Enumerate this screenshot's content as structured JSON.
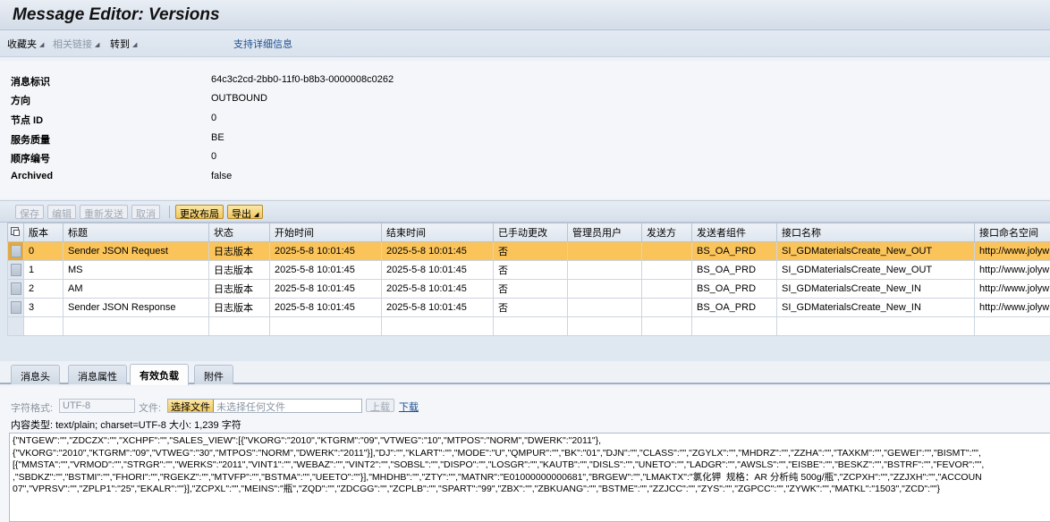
{
  "title": "Message Editor: Versions",
  "menu": {
    "favorites": "收藏夹",
    "related_links": "相关链接",
    "goto": "转到",
    "support": "支持详细信息"
  },
  "header_fields": [
    {
      "label": "消息标识",
      "value": "64c3c2cd-2bb0-11f0-b8b3-0000008c0262"
    },
    {
      "label": "方向",
      "value": "OUTBOUND"
    },
    {
      "label": "节点 ID",
      "value": "0"
    },
    {
      "label": "服务质量",
      "value": "BE"
    },
    {
      "label": "顺序编号",
      "value": "0"
    },
    {
      "label": "Archived",
      "value": "false"
    }
  ],
  "toolbar": {
    "save": "保存",
    "edit": "编辑",
    "resend": "重新发送",
    "cancel": "取消",
    "change_layout": "更改布局",
    "export": "导出"
  },
  "table": {
    "columns": [
      "版本",
      "标题",
      "状态",
      "开始时间",
      "结束时间",
      "已手动更改",
      "管理员用户",
      "发送方",
      "发送者组件",
      "接口名称",
      "接口命名空间"
    ],
    "rows": [
      [
        "0",
        "Sender JSON Request",
        "日志版本",
        "2025-5-8 10:01:45",
        "2025-5-8 10:01:45",
        "否",
        "",
        "",
        "BS_OA_PRD",
        "SI_GDMaterialsCreate_New_OUT",
        "http://www.jolyw"
      ],
      [
        "1",
        "MS",
        "日志版本",
        "2025-5-8 10:01:45",
        "2025-5-8 10:01:45",
        "否",
        "",
        "",
        "BS_OA_PRD",
        "SI_GDMaterialsCreate_New_OUT",
        "http://www.jolyw"
      ],
      [
        "2",
        "AM",
        "日志版本",
        "2025-5-8 10:01:45",
        "2025-5-8 10:01:45",
        "否",
        "",
        "",
        "BS_OA_PRD",
        "SI_GDMaterialsCreate_New_IN",
        "http://www.jolyw"
      ],
      [
        "3",
        "Sender JSON Response",
        "日志版本",
        "2025-5-8 10:01:45",
        "2025-5-8 10:01:45",
        "否",
        "",
        "",
        "BS_OA_PRD",
        "SI_GDMaterialsCreate_New_IN",
        "http://www.jolyw"
      ]
    ]
  },
  "tabs": [
    "消息头",
    "消息属性",
    "有效负载",
    "附件"
  ],
  "payload": {
    "charset_label": "字符格式:",
    "charset_value": "UTF-8",
    "file_label": "文件:",
    "choose_file": "选择文件",
    "no_file": "未选择任何文件",
    "upload": "上载",
    "download": "下载",
    "content_type_label": "内容类型:",
    "content_type_value": "text/plain; charset=UTF-8",
    "size_label": "大小:",
    "size_value": "1,239 字符",
    "lines": [
      "{\"NTGEW\":\"\",\"ZDCZX\":\"\",\"XCHPF\":\"\",\"SALES_VIEW\":[{\"VKORG\":\"2010\",\"KTGRM\":\"09\",\"VTWEG\":\"10\",\"MTPOS\":\"NORM\",\"DWERK\":\"2011\"},",
      "{\"VKORG\":\"2010\",\"KTGRM\":\"09\",\"VTWEG\":\"30\",\"MTPOS\":\"NORM\",\"DWERK\":\"2011\"}],\"DJ\":\"\",\"KLART\":\"\",\"MODE\":\"U\",\"QMPUR\":\"\",\"BK\":\"01\",\"DJN\":\"\",\"CLASS\":\"\",\"ZGYLX\":\"\",\"MHDRZ\":\"\",\"ZZHA\":\"\",\"TAXKM\":\"\",\"GEWEI\":\"\",\"BISMT\":\"\",",
      "[{\"MMSTA\":\"\",\"VRMOD\":\"\",\"STRGR\":\"\",\"WERKS\":\"2011\",\"VINT1\":\"\",\"WEBAZ\":\"\",\"VINT2\":\"\",\"SOBSL\":\"\",\"DISPO\":\"\",\"LOSGR\":\"\",\"KAUTB\":\"\",\"DISLS\":\"\",\"UNETO\":\"\",\"LADGR\":\"\",\"AWSLS\":\"\",\"EISBE\":\"\",\"BESKZ\":\"\",\"BSTRF\":\"\",\"FEVOR\":\"\",",
      ",\"SBDKZ\":\"\",\"BSTMI\":\"\",\"FHORI\":\"\",\"RGEKZ\":\"\",\"MTVFP\":\"\",\"BSTMA\":\"\",\"UEETO\":\"\"}],\"MHDHB\":\"\",\"ZTY\":\"\",\"MATNR\":\"E01000000000681\",\"BRGEW\":\"\",\"LMAKTX\":\"氯化钾  规格：AR 分析纯 500g/瓶\",\"ZCPXH\":\"\",\"ZZJXH\":\"\",\"ACCOUN",
      "07\",\"VPRSV\":\"\",\"ZPLP1\":\"25\",\"EKALR\":\"\"}],\"ZCPXL\":\"\",\"MEINS\":\"瓶\",\"ZQD\":\"\",\"ZDCGG\":\"\",\"ZCPLB\":\"\",\"SPART\":\"99\",\"ZBX\":\"\",\"ZBKUANG\":\"\",\"BSTME\":\"\",\"ZZJCC\":\"\",\"ZYS\":\"\",\"ZGPCC\":\"\",\"ZYWK\":\"\",\"MATKL\":\"1503\",\"ZCD\":\"\"}"
    ]
  }
}
